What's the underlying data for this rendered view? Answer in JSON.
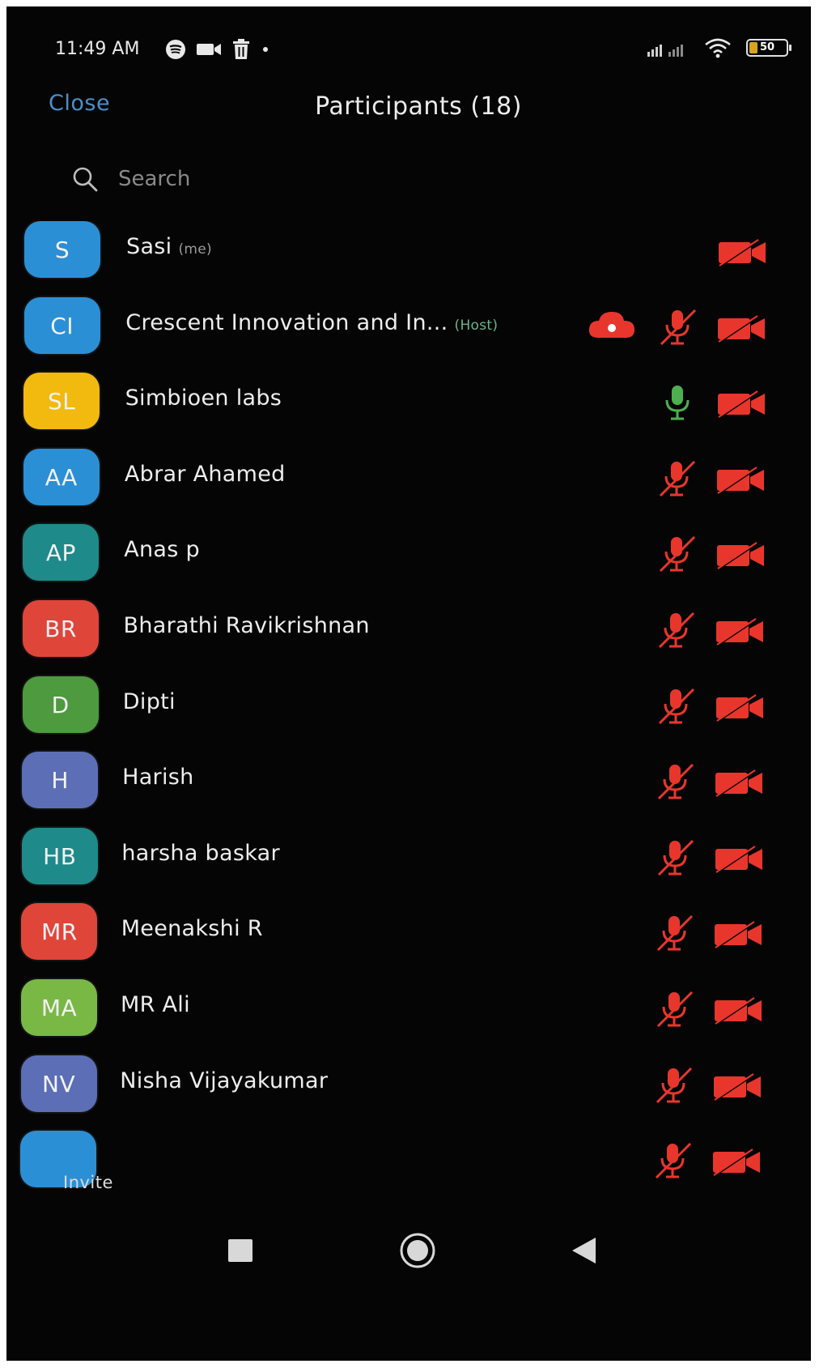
{
  "status_bar": {
    "time": "11:49 AM",
    "left_icons": [
      "spotify-icon",
      "video-icon",
      "trash-icon",
      "dot-icon"
    ],
    "right_icons": [
      "signal-icon",
      "wifi-icon",
      "battery-icon"
    ],
    "battery_level": "50"
  },
  "header": {
    "close_label": "Close",
    "title": "Participants (18)"
  },
  "search": {
    "placeholder": "Search",
    "value": ""
  },
  "colors": {
    "muted_red": "#e8362c",
    "active_green": "#4caf50",
    "close_link": "#4a8fc7"
  },
  "participants": [
    {
      "initials": "S",
      "name": "Sasi",
      "tag": "(me)",
      "color": "#2b8fd6",
      "mic": "none",
      "video": "off",
      "recording": false
    },
    {
      "initials": "CI",
      "name": "Crescent Innovation and In...",
      "tag": "(Host)",
      "color": "#2b8fd6",
      "mic": "muted",
      "video": "off",
      "recording": true
    },
    {
      "initials": "SL",
      "name": "Simbioen labs",
      "tag": "",
      "color": "#f2b90f",
      "mic": "on",
      "video": "off",
      "recording": false
    },
    {
      "initials": "AA",
      "name": "Abrar Ahamed",
      "tag": "",
      "color": "#2b8fd6",
      "mic": "muted",
      "video": "off",
      "recording": false
    },
    {
      "initials": "AP",
      "name": "Anas p",
      "tag": "",
      "color": "#1e8a8a",
      "mic": "muted",
      "video": "off",
      "recording": false
    },
    {
      "initials": "BR",
      "name": "Bharathi Ravikrishnan",
      "tag": "",
      "color": "#e0453a",
      "mic": "muted",
      "video": "off",
      "recording": false
    },
    {
      "initials": "D",
      "name": "Dipti",
      "tag": "",
      "color": "#4e9a3e",
      "mic": "muted",
      "video": "off",
      "recording": false
    },
    {
      "initials": "H",
      "name": "Harish",
      "tag": "",
      "color": "#5b6eb6",
      "mic": "muted",
      "video": "off",
      "recording": false
    },
    {
      "initials": "HB",
      "name": "harsha baskar",
      "tag": "",
      "color": "#1e8a8a",
      "mic": "muted",
      "video": "off",
      "recording": false
    },
    {
      "initials": "MR",
      "name": "Meenakshi R",
      "tag": "",
      "color": "#e0453a",
      "mic": "muted",
      "video": "off",
      "recording": false
    },
    {
      "initials": "MA",
      "name": "MR Ali",
      "tag": "",
      "color": "#7ab846",
      "mic": "muted",
      "video": "off",
      "recording": false
    },
    {
      "initials": "NV",
      "name": "Nisha Vijayakumar",
      "tag": "",
      "color": "#5b6eb6",
      "mic": "muted",
      "video": "off",
      "recording": false
    },
    {
      "initials": "",
      "name": "",
      "tag": "",
      "color": "#2b8fd6",
      "mic": "muted",
      "video": "off",
      "recording": false
    }
  ],
  "footer": {
    "invite_label": "Invite"
  },
  "navigation": [
    "square-recents-icon",
    "circle-home-icon",
    "triangle-back-icon"
  ]
}
